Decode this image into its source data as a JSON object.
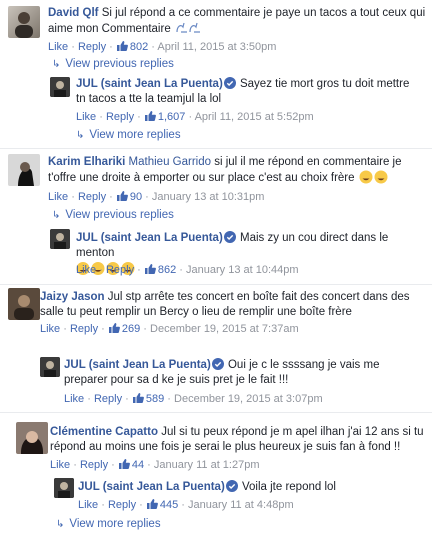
{
  "threads": [
    {
      "comment": {
        "author": "David Qlf",
        "text": "Si jul répond a ce commentaire je paye un tacos a tout ceux qui aime mon Commentaire",
        "like": "Like",
        "reply": "Reply",
        "likes": "802",
        "time": "April 11, 2015 at 3:50pm"
      },
      "view_previous": "View previous replies",
      "reply": {
        "author": "JUL (saint Jean La Puenta)",
        "text": "Sayez tie mort gros tu doit mettre tn tacos a tte la teamjul la lol",
        "like": "Like",
        "reply": "Reply",
        "likes": "1,607",
        "time": "April 11, 2015 at 5:52pm"
      },
      "view_more": "View more replies"
    },
    {
      "comment": {
        "author": "Karim Elhariki",
        "mention": "Mathieu Garrido",
        "text": "si jul il me répond en commentaire je t'offre une droite à emporter ou sur place c'est au choix frère",
        "like": "Like",
        "reply": "Reply",
        "likes": "90",
        "time": "January 13 at 10:31pm"
      },
      "view_previous": "View previous replies",
      "reply": {
        "author": "JUL (saint Jean La Puenta)",
        "text": "Mais zy un cou direct dans le menton",
        "like": "Like",
        "reply": "Reply",
        "likes": "862",
        "time": "January 13 at 10:44pm"
      }
    },
    {
      "comment": {
        "author": "Jaizy Jason",
        "text": "Jul stp arrête tes concert en boîte fait des concert dans des salle tu peut remplir un Bercy o lieu de remplir une boîte frère",
        "like": "Like",
        "reply": "Reply",
        "likes": "269",
        "time": "December 19, 2015 at 7:37am"
      },
      "reply": {
        "author": "JUL (saint Jean La Puenta)",
        "text": "Oui je c le ssssang je vais me preparer pour sa d ke je suis pret je le fait !!!",
        "like": "Like",
        "reply": "Reply",
        "likes": "589",
        "time": "December 19, 2015 at 3:07pm"
      }
    },
    {
      "comment": {
        "author": "Clémentine Capatto",
        "text": "Jul si tu peux répond je m apel ilhan j'ai 12 ans si tu répond au moins une fois je serai le plus heureux je suis fan à fond !!",
        "like": "Like",
        "reply": "Reply",
        "likes": "44",
        "time": "January 11 at 1:27pm"
      },
      "reply": {
        "author": "JUL (saint Jean La Puenta)",
        "text": "Voila jte repond lol",
        "like": "Like",
        "reply": "Reply",
        "likes": "445",
        "time": "January 11 at 4:48pm"
      },
      "view_more": "View more replies"
    }
  ],
  "colors": {
    "link": "#365899",
    "action": "#4267b2",
    "meta": "#90949c",
    "divider": "#e9ebee"
  }
}
